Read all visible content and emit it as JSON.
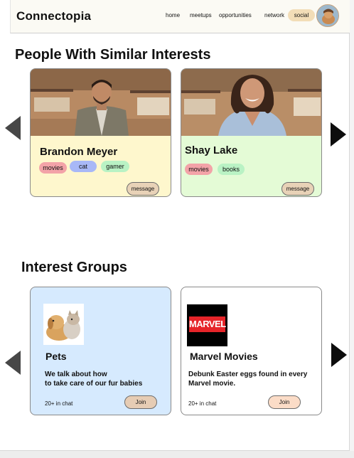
{
  "app": {
    "brand": "Connectopia"
  },
  "nav": {
    "items": [
      {
        "label": "home"
      },
      {
        "label": "meetups"
      },
      {
        "label": "opportunities"
      },
      {
        "label": "network"
      }
    ],
    "active": {
      "label": "social"
    },
    "avatar_icon": "profile-avatar"
  },
  "people_section": {
    "title": "People With Similar Interests",
    "people": [
      {
        "name": "Brandon Meyer",
        "tags": [
          {
            "label": "movies",
            "color": "#f3a3a8"
          },
          {
            "label": "cat",
            "color": "#a8b8f7"
          },
          {
            "label": "gamer",
            "color": "#b9f2c4"
          }
        ],
        "message_label": "message",
        "card_color": "#fef7cd"
      },
      {
        "name": "Shay Lake",
        "tags": [
          {
            "label": "movies",
            "color": "#f3a3a8"
          },
          {
            "label": "books",
            "color": "#b9f2c4"
          }
        ],
        "message_label": "message",
        "card_color": "#e4fbd6"
      }
    ]
  },
  "groups_section": {
    "title": "Interest Groups",
    "groups": [
      {
        "name": "Pets",
        "description_line1": "We talk about how",
        "description_line2": "to take care of our fur babies",
        "chat_count": "20+ in chat",
        "join_label": "Join",
        "card_color": "#d6eafe",
        "icon": "puppy-kitten-image"
      },
      {
        "name": "Marvel Movies",
        "description_line1": "Debunk Easter eggs found in every",
        "description_line2": "Marvel movie.",
        "chat_count": "20+ in chat",
        "join_label": "Join",
        "card_color": "#ffffff",
        "logo_text": "MARVEL",
        "icon": "marvel-logo"
      }
    ]
  },
  "colors": {
    "navbar_bg": "#fbfaf4",
    "social_pill": "#f2ddb7",
    "button_bg": "#e8d2b7",
    "join_bg_pets": "#e6ccb4",
    "join_bg_marvel": "#fbdcc7",
    "marvel_red": "#e62429"
  }
}
